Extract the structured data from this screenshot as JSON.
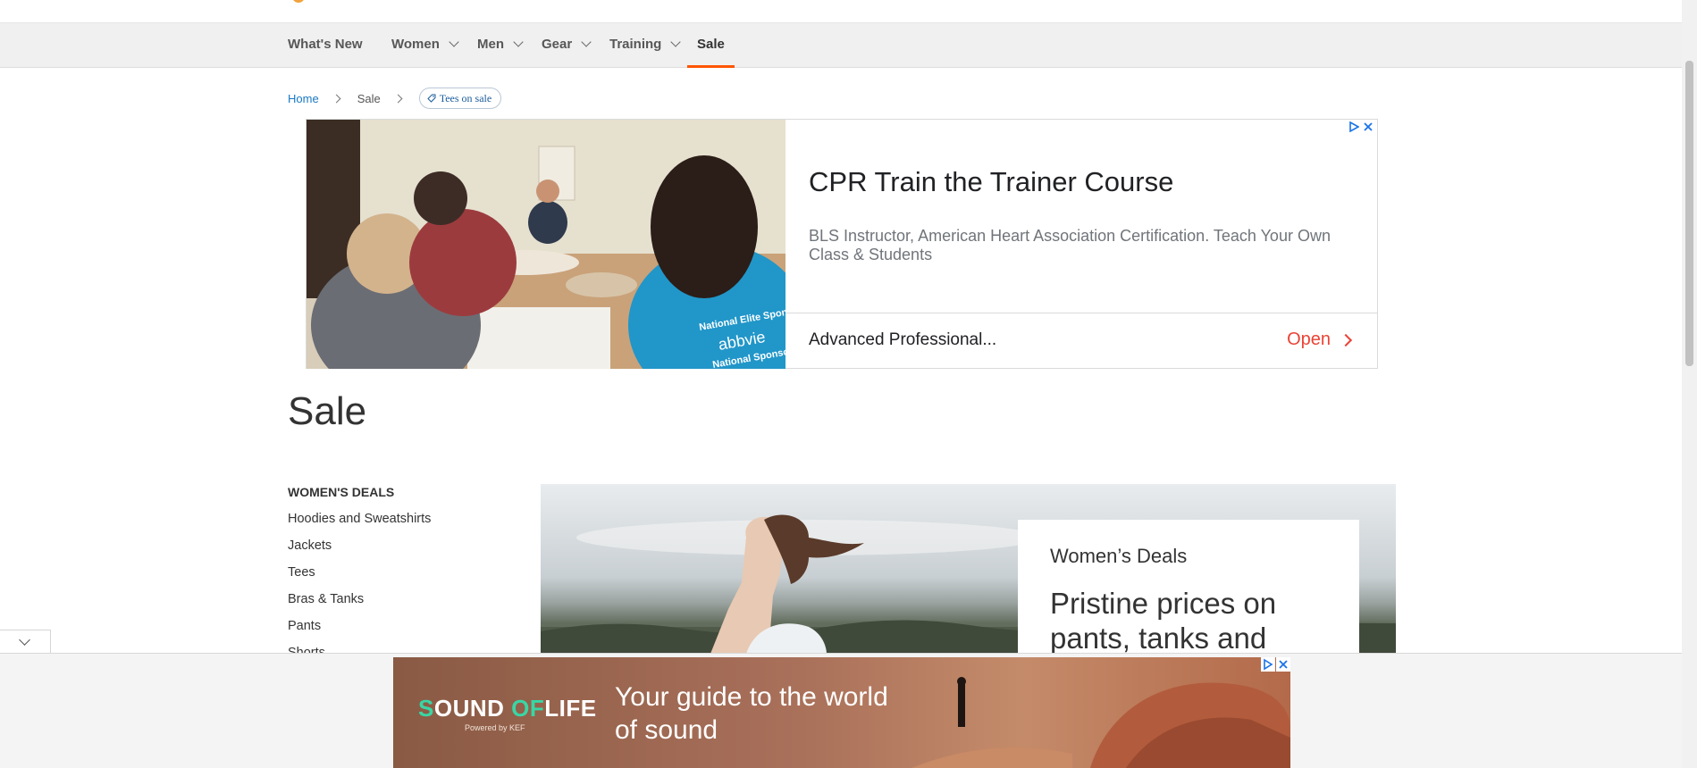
{
  "nav": {
    "items": [
      {
        "label": "What's New",
        "has_dropdown": false
      },
      {
        "label": "Women",
        "has_dropdown": true
      },
      {
        "label": "Men",
        "has_dropdown": true
      },
      {
        "label": "Gear",
        "has_dropdown": true
      },
      {
        "label": "Training",
        "has_dropdown": true
      },
      {
        "label": "Sale",
        "has_dropdown": false,
        "active": true
      }
    ],
    "active_color": "#ff5501"
  },
  "breadcrumb": {
    "home": "Home",
    "current": "Sale",
    "chip": "Tees on sale"
  },
  "ad_top": {
    "title": "CPR Train the Trainer Course",
    "description": "BLS Instructor, American Heart Association Certification. Teach Your Own Class & Students",
    "footer": "Advanced Professional...",
    "cta": "Open",
    "image_text_1": "National Elite Sponsor",
    "image_text_2": "abbvie",
    "image_text_3": "National Sponsor"
  },
  "page": {
    "title": "Sale"
  },
  "sidebar": {
    "title": "WOMEN'S DEALS",
    "items": [
      {
        "label": "Hoodies and Sweatshirts"
      },
      {
        "label": "Jackets"
      },
      {
        "label": "Tees"
      },
      {
        "label": "Bras & Tanks"
      },
      {
        "label": "Pants"
      },
      {
        "label": "Shorts"
      }
    ]
  },
  "banner": {
    "kicker": "Women’s Deals",
    "headline": "Pristine prices on pants, tanks and"
  },
  "ad_bottom": {
    "brand_pre": "S",
    "brand_main": "OUND",
    "brand_mid": "OF",
    "brand_end": "LIFE",
    "brand_sub": "Powered by KEF",
    "text": "Your guide to the world of sound"
  },
  "icons": [
    "chevron-down-icon",
    "chevron-right-icon",
    "tag-icon",
    "adchoices-icon",
    "close-icon"
  ]
}
